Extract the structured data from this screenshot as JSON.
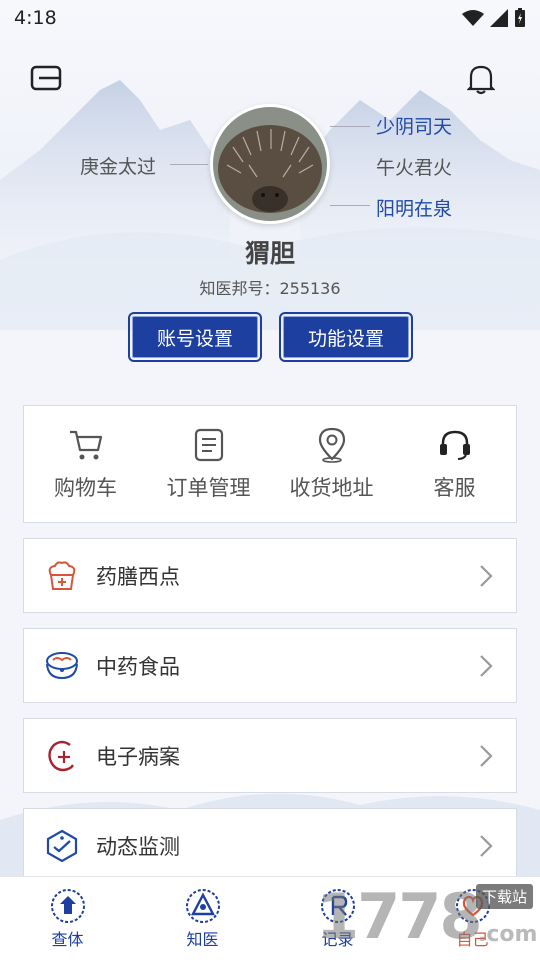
{
  "status_bar": {
    "time": "4:18"
  },
  "profile": {
    "name": "猬胆",
    "id_label": "知医邦号：255136",
    "labels": {
      "left": "庚金太过",
      "right_top": "少阴司天",
      "right_middle": "午火君火",
      "right_bottom": "阳明在泉"
    }
  },
  "buttons": {
    "account_settings": "账号设置",
    "function_settings": "功能设置"
  },
  "quick_actions": [
    {
      "label": "购物车",
      "icon": "cart-icon"
    },
    {
      "label": "订单管理",
      "icon": "order-list-icon"
    },
    {
      "label": "收货地址",
      "icon": "location-pin-icon"
    },
    {
      "label": "客服",
      "icon": "headset-icon"
    }
  ],
  "menu": [
    {
      "label": "药膳西点",
      "icon": "cake-icon",
      "color": "#d9553a"
    },
    {
      "label": "中药食品",
      "icon": "herbal-bowl-icon",
      "color": "#1f4aa8"
    },
    {
      "label": "电子病案",
      "icon": "medical-record-icon",
      "color": "#a8232b"
    },
    {
      "label": "动态监测",
      "icon": "monitor-shield-icon",
      "color": "#1f4aa8"
    }
  ],
  "tabbar": [
    {
      "label": "查体",
      "icon": "body-check-icon"
    },
    {
      "label": "知医",
      "icon": "know-medicine-icon"
    },
    {
      "label": "记录",
      "icon": "record-icon"
    },
    {
      "label": "自己",
      "icon": "self-heart-icon"
    }
  ],
  "watermark": {
    "text": "1778",
    "badge": "下载站",
    "suffix": ".com"
  },
  "colors": {
    "primary": "#1c3fa0",
    "accent_blue": "#1f4aa8",
    "accent_red": "#d9553a"
  }
}
